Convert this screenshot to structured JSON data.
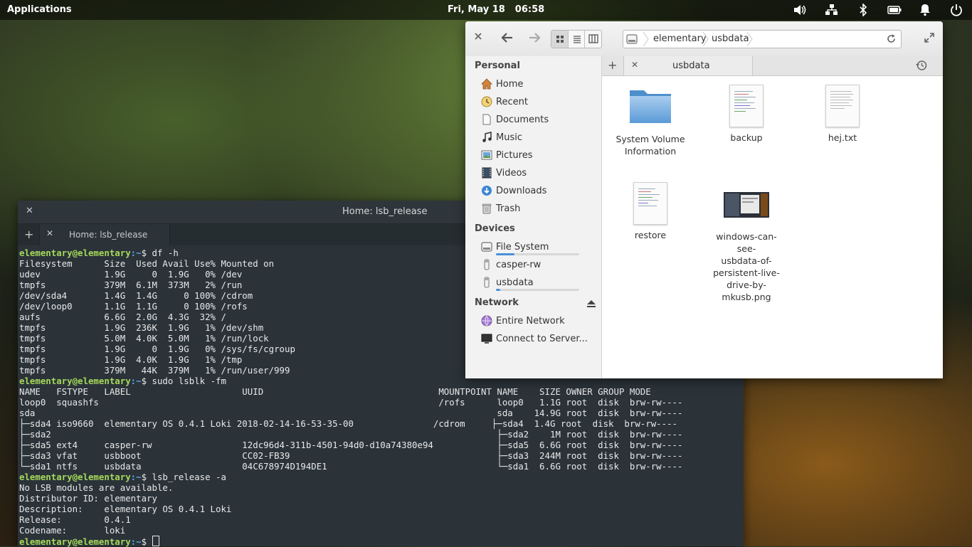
{
  "panel": {
    "applications": "Applications",
    "date": "Fri, May 18",
    "time": "06:58",
    "indicators": [
      "volume-icon",
      "network-icon",
      "bluetooth-icon",
      "battery-icon",
      "notifications-icon",
      "power-icon"
    ]
  },
  "terminal": {
    "title": "Home: lsb_release",
    "tab_label": "Home: lsb_release",
    "prompt_user": "elementary@elementary",
    "prompt_path": ":~",
    "prompt_symbol": "$",
    "commands": [
      "df -h",
      "sudo lsblk -fm",
      "lsb_release -a"
    ],
    "df_output": [
      "Filesystem      Size  Used Avail Use% Mounted on",
      "udev            1.9G     0  1.9G   0% /dev",
      "tmpfs           379M  6.1M  373M   2% /run",
      "/dev/sda4       1.4G  1.4G     0 100% /cdrom",
      "/dev/loop0      1.1G  1.1G     0 100% /rofs",
      "aufs            6.6G  2.0G  4.3G  32% /",
      "tmpfs           1.9G  236K  1.9G   1% /dev/shm",
      "tmpfs           5.0M  4.0K  5.0M   1% /run/lock",
      "tmpfs           1.9G     0  1.9G   0% /sys/fs/cgroup",
      "tmpfs           1.9G  4.0K  1.9G   1% /tmp",
      "tmpfs           379M   44K  379M   1% /run/user/999"
    ],
    "lsblk_output": [
      "NAME   FSTYPE   LABEL                     UUID                                 MOUNTPOINT NAME    SIZE OWNER GROUP MODE",
      "loop0  squashfs                                                                /rofs      loop0   1.1G root  disk  brw-rw----",
      "sda                                                                                       sda    14.9G root  disk  brw-rw----",
      "├─sda4 iso9660  elementary OS 0.4.1 Loki 2018-02-14-16-53-35-00               /cdrom     ├─sda4  1.4G root  disk  brw-rw----",
      "├─sda2                                                                                    ├─sda2    1M root  disk  brw-rw----",
      "├─sda5 ext4     casper-rw                 12dc96d4-311b-4501-94d0-d10a74380e94            ├─sda5  6.6G root  disk  brw-rw----",
      "├─sda3 vfat     usbboot                   CC02-FB39                                       ├─sda3  244M root  disk  brw-rw----",
      "└─sda1 ntfs     usbdata                   04C678974D194DE1                                └─sda1  6.6G root  disk  brw-rw----"
    ],
    "lsb_output": [
      "No LSB modules are available.",
      "Distributor ID: elementary",
      "Description:    elementary OS 0.4.1 Loki",
      "Release:        0.4.1",
      "Codename:       loki"
    ]
  },
  "files": {
    "path": [
      "elementary",
      "usbdata"
    ],
    "tab_label": "usbdata",
    "sidebar": {
      "personal_heading": "Personal",
      "personal": [
        {
          "label": "Home",
          "icon": "home-icon"
        },
        {
          "label": "Recent",
          "icon": "recent-icon"
        },
        {
          "label": "Documents",
          "icon": "documents-icon"
        },
        {
          "label": "Music",
          "icon": "music-icon"
        },
        {
          "label": "Pictures",
          "icon": "pictures-icon"
        },
        {
          "label": "Videos",
          "icon": "videos-icon"
        },
        {
          "label": "Downloads",
          "icon": "downloads-icon"
        },
        {
          "label": "Trash",
          "icon": "trash-icon"
        }
      ],
      "devices_heading": "Devices",
      "devices": [
        {
          "label": "File System",
          "icon": "drive-icon",
          "usage": 0.22
        },
        {
          "label": "casper-rw",
          "icon": "usb-icon"
        },
        {
          "label": "usbdata",
          "icon": "usb-icon",
          "usage": 0.05
        }
      ],
      "network_heading": "Network",
      "network": [
        {
          "label": "Entire Network",
          "icon": "network-icon"
        },
        {
          "label": "Connect to Server...",
          "icon": "server-icon"
        }
      ]
    },
    "items": [
      {
        "name": "System Volume\nInformation",
        "type": "folder"
      },
      {
        "name": "backup",
        "type": "document"
      },
      {
        "name": "hej.txt",
        "type": "text"
      },
      {
        "name": "restore",
        "type": "document"
      },
      {
        "name": "windows-can-see-\nusbdata-of-\npersistent-live-\ndrive-by-\nmkusb.png",
        "type": "image"
      }
    ]
  }
}
